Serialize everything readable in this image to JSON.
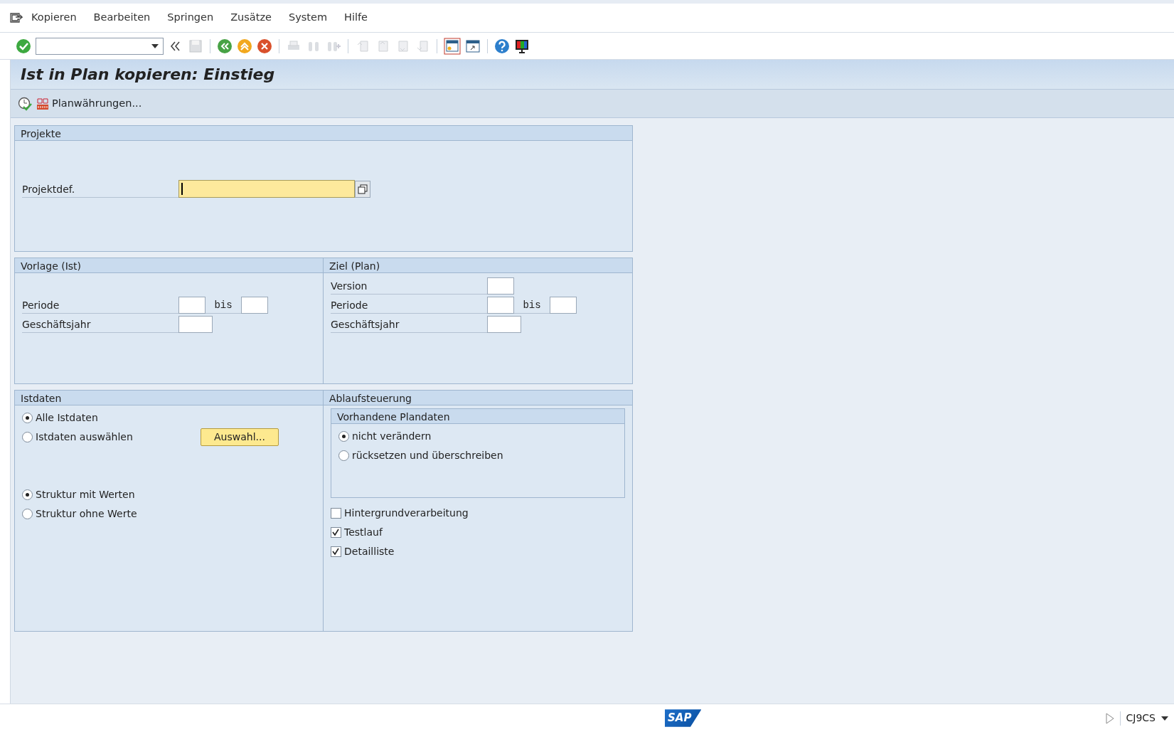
{
  "menu": [
    {
      "label": "Kopieren"
    },
    {
      "label": "Bearbeiten"
    },
    {
      "label": "Springen"
    },
    {
      "label": "Zusätze"
    },
    {
      "label": "System"
    },
    {
      "label": "Hilfe"
    }
  ],
  "toolbar": [
    {
      "kind": "enter",
      "disabled": false
    },
    {
      "kind": "command"
    },
    {
      "kind": "collapse",
      "disabled": false
    },
    {
      "kind": "save",
      "disabled": true
    },
    {
      "kind": "sep"
    },
    {
      "kind": "back",
      "disabled": false
    },
    {
      "kind": "exit",
      "disabled": false
    },
    {
      "kind": "cancel",
      "disabled": false
    },
    {
      "kind": "sep"
    },
    {
      "kind": "print",
      "disabled": true
    },
    {
      "kind": "find",
      "disabled": true
    },
    {
      "kind": "findnext",
      "disabled": true
    },
    {
      "kind": "sep"
    },
    {
      "kind": "first",
      "disabled": true
    },
    {
      "kind": "prev",
      "disabled": true
    },
    {
      "kind": "next",
      "disabled": true
    },
    {
      "kind": "last",
      "disabled": true
    },
    {
      "kind": "sep"
    },
    {
      "kind": "newsession",
      "disabled": false
    },
    {
      "kind": "shortcut",
      "disabled": false
    },
    {
      "kind": "sep"
    },
    {
      "kind": "help",
      "disabled": false
    },
    {
      "kind": "layout",
      "disabled": false
    }
  ],
  "title": "Ist in Plan kopieren: Einstieg",
  "app_toolbar": [
    {
      "kind": "execute"
    },
    {
      "kind": "currency",
      "label": "Planwährungen..."
    }
  ],
  "projekte": {
    "title": "Projekte",
    "fields": [
      {
        "label": "Projektdef.",
        "focused": true
      }
    ]
  },
  "vorlage": {
    "title": "Vorlage (Ist)",
    "rows": [
      {
        "kind": "range",
        "label": "Periode",
        "to_label": "bis"
      },
      {
        "kind": "year",
        "label": "Geschäftsjahr"
      }
    ]
  },
  "ziel": {
    "title": "Ziel (Plan)",
    "rows": [
      {
        "kind": "single",
        "label": "Version"
      },
      {
        "kind": "range",
        "label": "Periode",
        "to_label": "bis"
      },
      {
        "kind": "year",
        "label": "Geschäftsjahr"
      }
    ]
  },
  "istdaten": {
    "title": "Istdaten",
    "groups": [
      [
        {
          "label": "Alle Istdaten",
          "selected": true
        },
        {
          "label": "Istdaten auswählen",
          "selected": false,
          "button": "Auswahl..."
        }
      ],
      [
        {
          "label": "Struktur mit Werten",
          "selected": true
        },
        {
          "label": "Struktur ohne Werte",
          "selected": false
        }
      ]
    ]
  },
  "ablauf": {
    "title": "Ablaufsteuerung",
    "subgroup": {
      "title": "Vorhandene Plandaten",
      "options": [
        {
          "label": "nicht verändern",
          "selected": true
        },
        {
          "label": "rücksetzen und überschreiben",
          "selected": false
        }
      ]
    },
    "checkboxes": [
      {
        "label": "Hintergrundverarbeitung",
        "checked": false
      },
      {
        "label": "Testlauf",
        "checked": true
      },
      {
        "label": "Detailliste",
        "checked": true
      }
    ]
  },
  "status_bar": {
    "logo": "SAP",
    "transaction": "CJ9CS"
  }
}
